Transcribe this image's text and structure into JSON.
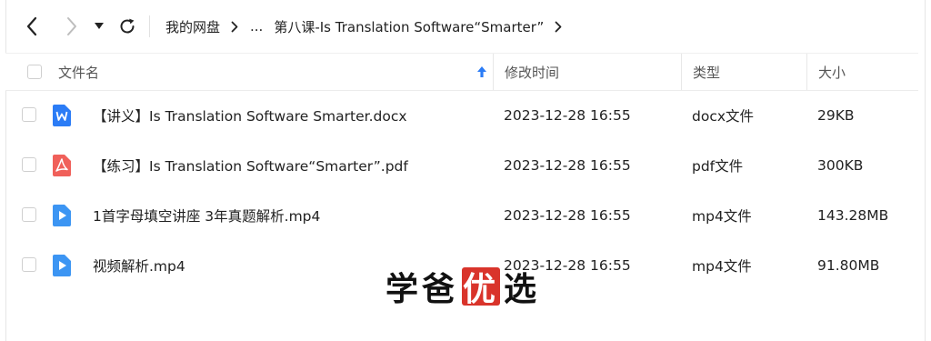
{
  "toolbar": {
    "breadcrumb": [
      {
        "label": "我的网盘"
      },
      {
        "label": "..."
      },
      {
        "label": "第八课-Is Translation Software“Smarter”"
      }
    ]
  },
  "table": {
    "columns": {
      "name": "文件名",
      "modified": "修改时间",
      "type": "类型",
      "size": "大小"
    },
    "rows": [
      {
        "name": "【讲义】Is Translation Software Smarter.docx",
        "modified": "2023-12-28 16:55",
        "type": "docx文件",
        "size": "29KB",
        "icon": "word-file-icon",
        "icon_color": "#2b7cf6"
      },
      {
        "name": "【练习】Is Translation Software“Smarter”.pdf",
        "modified": "2023-12-28 16:55",
        "type": "pdf文件",
        "size": "300KB",
        "icon": "pdf-file-icon",
        "icon_color": "#f0605a"
      },
      {
        "name": "1首字母填空讲座 3年真题解析.mp4",
        "modified": "2023-12-28 16:55",
        "type": "mp4文件",
        "size": "143.28MB",
        "icon": "video-file-icon",
        "icon_color": "#3c95f3"
      },
      {
        "name": "视频解析.mp4",
        "modified": "2023-12-28 16:55",
        "type": "mp4文件",
        "size": "91.80MB",
        "icon": "video-file-icon",
        "icon_color": "#3c95f3"
      }
    ]
  },
  "watermark": {
    "chars": [
      "学",
      "爸",
      "优",
      "选"
    ],
    "stamp_color": "#d9342b"
  }
}
